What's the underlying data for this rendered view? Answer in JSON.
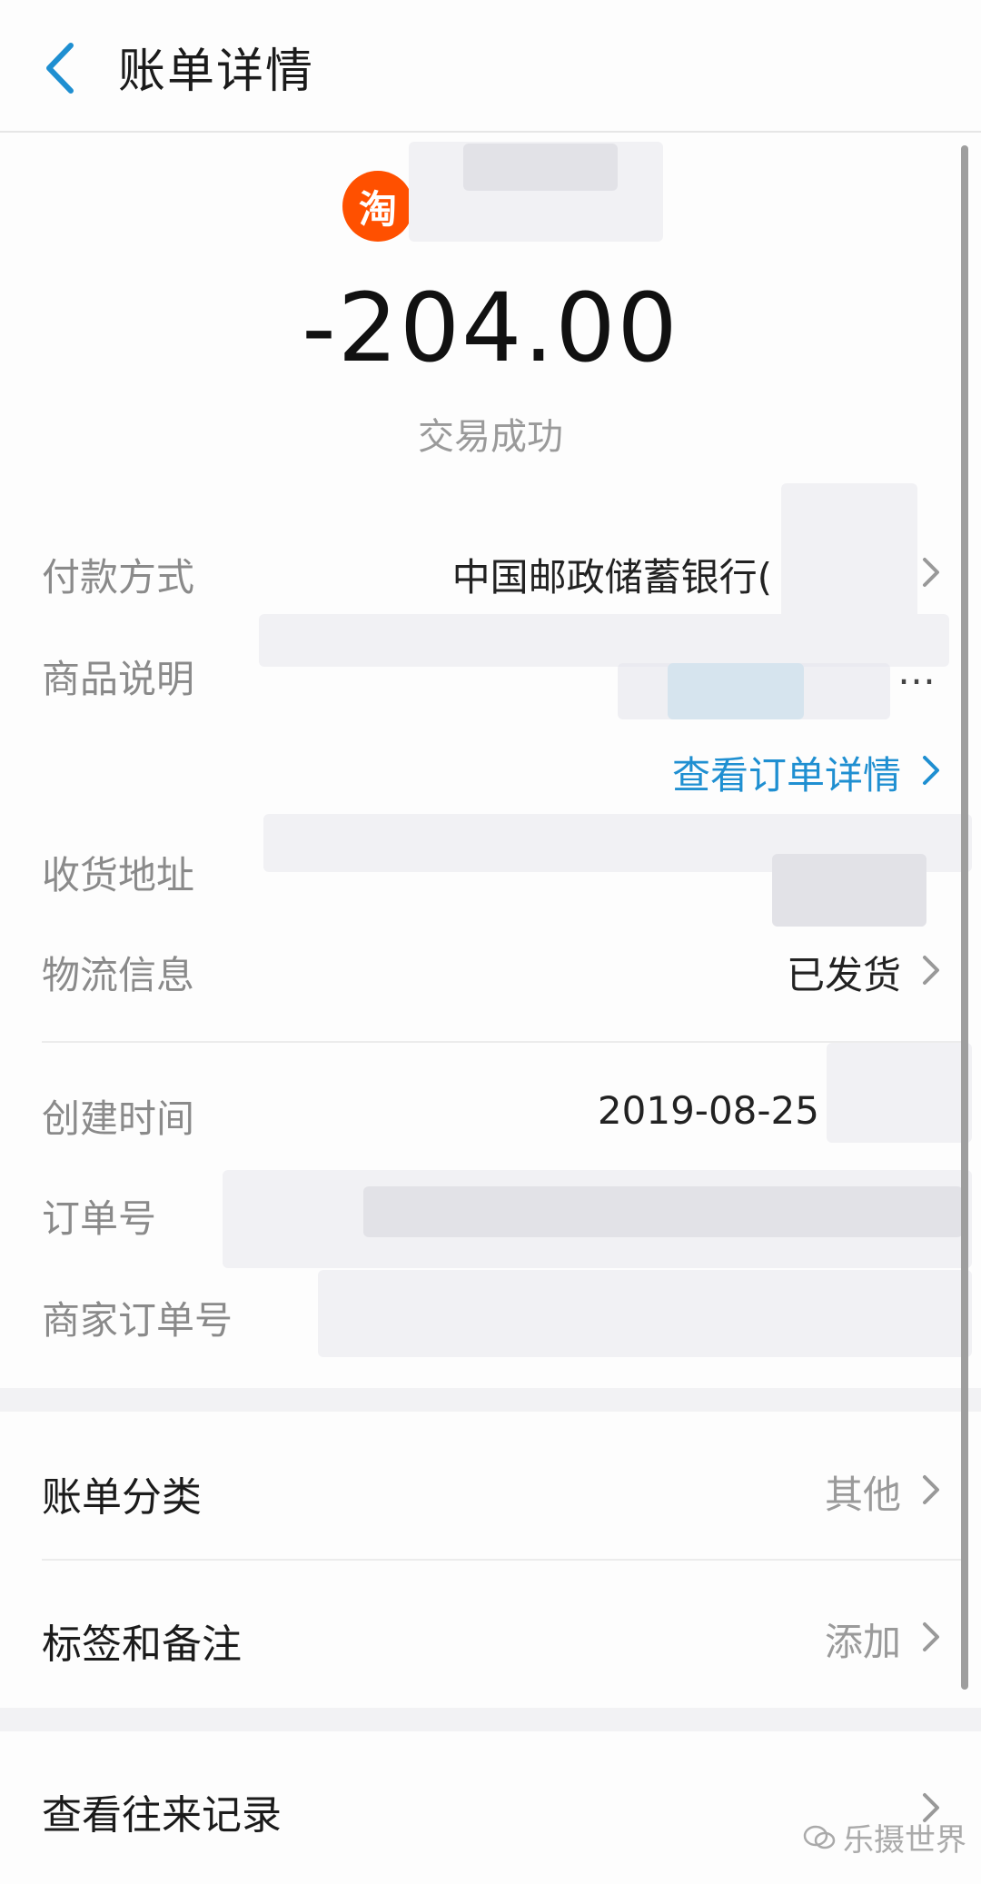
{
  "header": {
    "title": "账单详情"
  },
  "merchant": {
    "logo_text": "淘"
  },
  "summary": {
    "amount": "-204.00",
    "status": "交易成功"
  },
  "details": {
    "payment_method": {
      "label": "付款方式",
      "value": "中国邮政储蓄银行("
    },
    "product_desc": {
      "label": "商品说明",
      "ellipsis": "…"
    },
    "order_link": "查看订单详情",
    "address": {
      "label": "收货地址"
    },
    "logistics": {
      "label": "物流信息",
      "value": "已发货"
    },
    "created_time": {
      "label": "创建时间",
      "value": "2019-08-25"
    },
    "order_no": {
      "label": "订单号"
    },
    "merchant_order_no": {
      "label": "商家订单号"
    }
  },
  "menu": {
    "category": {
      "label": "账单分类",
      "value": "其他"
    },
    "tags": {
      "label": "标签和备注",
      "value": "添加"
    },
    "records": {
      "label": "查看往来记录"
    }
  },
  "watermark": "乐摄世界",
  "colors": {
    "accent": "#1f8fd1",
    "taobao_orange": "#ff5000"
  }
}
